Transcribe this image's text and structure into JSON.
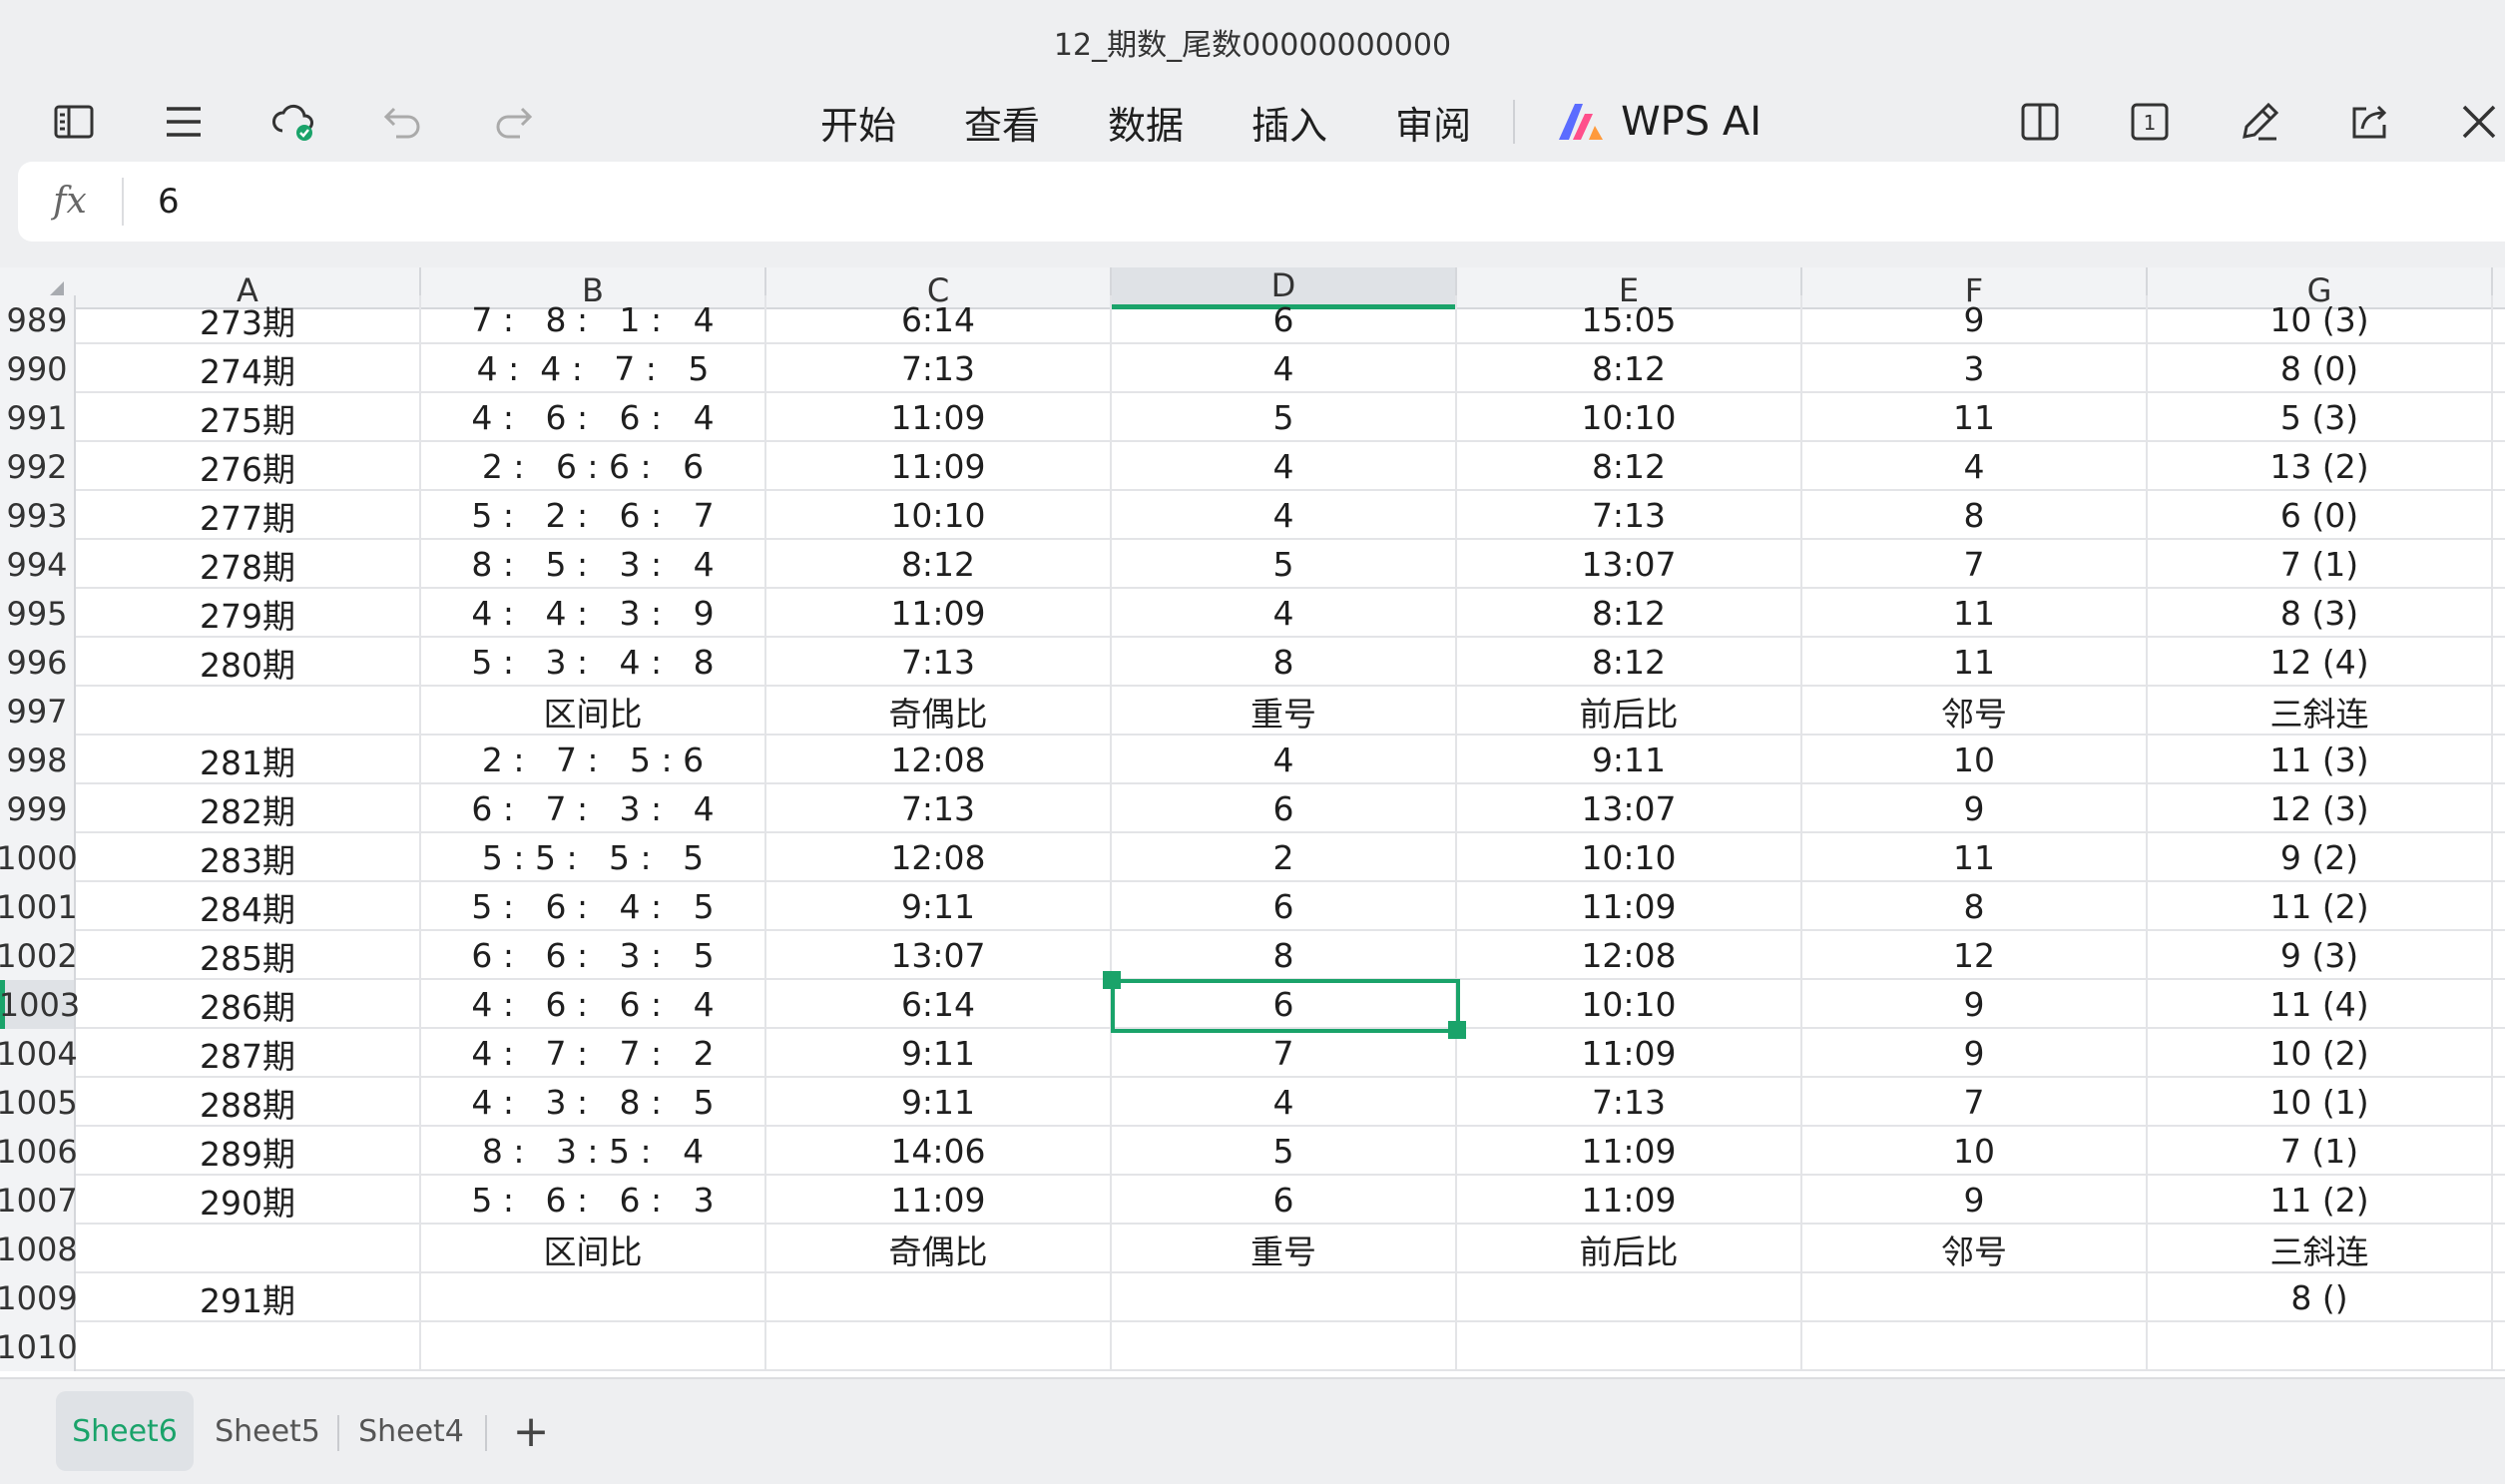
{
  "window": {
    "title": "12_期数_尾数00000000000"
  },
  "toolbar": {
    "menus": [
      "开始",
      "查看",
      "数据",
      "插入",
      "审阅"
    ],
    "ai_label": "WPS AI"
  },
  "formula_bar": {
    "fx_label": "fx",
    "value": "6"
  },
  "grid": {
    "columns": [
      "A",
      "B",
      "C",
      "D",
      "E",
      "F",
      "G"
    ],
    "selected_column": "D",
    "selected_row": "1003",
    "rows": [
      {
        "num": "989",
        "cells": [
          "273期",
          "7 :   8 :   1 :   4",
          "6:14",
          "6",
          "15:05",
          "9",
          "10 (3)"
        ]
      },
      {
        "num": "990",
        "cells": [
          "274期",
          "4 :  4 :   7 :   5",
          "7:13",
          "4",
          "8:12",
          "3",
          "8 (0)"
        ]
      },
      {
        "num": "991",
        "cells": [
          "275期",
          "4 :   6 :   6 :   4",
          "11:09",
          "5",
          "10:10",
          "11",
          "5 (3)"
        ]
      },
      {
        "num": "992",
        "cells": [
          "276期",
          "2 :   6 : 6 :   6",
          "11:09",
          "4",
          "8:12",
          "4",
          "13 (2)"
        ]
      },
      {
        "num": "993",
        "cells": [
          "277期",
          "5 :   2 :   6 :   7",
          "10:10",
          "4",
          "7:13",
          "8",
          "6 (0)"
        ]
      },
      {
        "num": "994",
        "cells": [
          "278期",
          "8 :   5 :   3 :   4",
          "8:12",
          "5",
          "13:07",
          "7",
          "7 (1)"
        ]
      },
      {
        "num": "995",
        "cells": [
          "279期",
          "4 :   4 :   3 :   9",
          "11:09",
          "4",
          "8:12",
          "11",
          "8 (3)"
        ]
      },
      {
        "num": "996",
        "cells": [
          "280期",
          "5 :   3 :   4 :   8",
          "7:13",
          "8",
          "8:12",
          "11",
          "12 (4)"
        ]
      },
      {
        "num": "997",
        "cells": [
          "",
          "区间比",
          "奇偶比",
          "重号",
          "前后比",
          "邻号",
          "三斜连"
        ]
      },
      {
        "num": "998",
        "cells": [
          "281期",
          "2 :   7 :   5 : 6",
          "12:08",
          "4",
          "9:11",
          "10",
          "11 (3)"
        ]
      },
      {
        "num": "999",
        "cells": [
          "282期",
          "6 :   7 :   3 :   4",
          "7:13",
          "6",
          "13:07",
          "9",
          "12 (3)"
        ]
      },
      {
        "num": "1000",
        "cells": [
          "283期",
          "5 : 5 :   5 :   5",
          "12:08",
          "2",
          "10:10",
          "11",
          "9 (2)"
        ]
      },
      {
        "num": "1001",
        "cells": [
          "284期",
          "5 :   6 :   4 :   5",
          "9:11",
          "6",
          "11:09",
          "8",
          "11 (2)"
        ]
      },
      {
        "num": "1002",
        "cells": [
          "285期",
          "6 :   6 :   3 :   5",
          "13:07",
          "8",
          "12:08",
          "12",
          "9 (3)"
        ]
      },
      {
        "num": "1003",
        "cells": [
          "286期",
          "4 :   6 :   6 :   4",
          "6:14",
          "6",
          "10:10",
          "9",
          "11 (4)"
        ]
      },
      {
        "num": "1004",
        "cells": [
          "287期",
          "4 :   7 :   7 :   2",
          "9:11",
          "7",
          "11:09",
          "9",
          "10 (2)"
        ]
      },
      {
        "num": "1005",
        "cells": [
          "288期",
          "4 :   3 :   8 :   5",
          "9:11",
          "4",
          "7:13",
          "7",
          "10 (1)"
        ]
      },
      {
        "num": "1006",
        "cells": [
          "289期",
          "8 :   3 : 5 :   4",
          "14:06",
          "5",
          "11:09",
          "10",
          "7 (1)"
        ]
      },
      {
        "num": "1007",
        "cells": [
          "290期",
          "5 :   6 :   6 :   3",
          "11:09",
          "6",
          "11:09",
          "9",
          "11 (2)"
        ]
      },
      {
        "num": "1008",
        "cells": [
          "",
          "区间比",
          "奇偶比",
          "重号",
          "前后比",
          "邻号",
          "三斜连"
        ]
      },
      {
        "num": "1009",
        "cells": [
          "291期",
          "",
          "",
          "",
          "",
          "",
          "8 ()"
        ]
      },
      {
        "num": "1010",
        "cells": [
          "",
          "",
          "",
          "",
          "",
          "",
          ""
        ]
      }
    ]
  },
  "sheets": {
    "tabs": [
      "Sheet6",
      "Sheet5",
      "Sheet4"
    ],
    "active": "Sheet6",
    "add_label": "+"
  },
  "colors": {
    "accent": "#1aa36a",
    "background": "#eeeff1"
  }
}
